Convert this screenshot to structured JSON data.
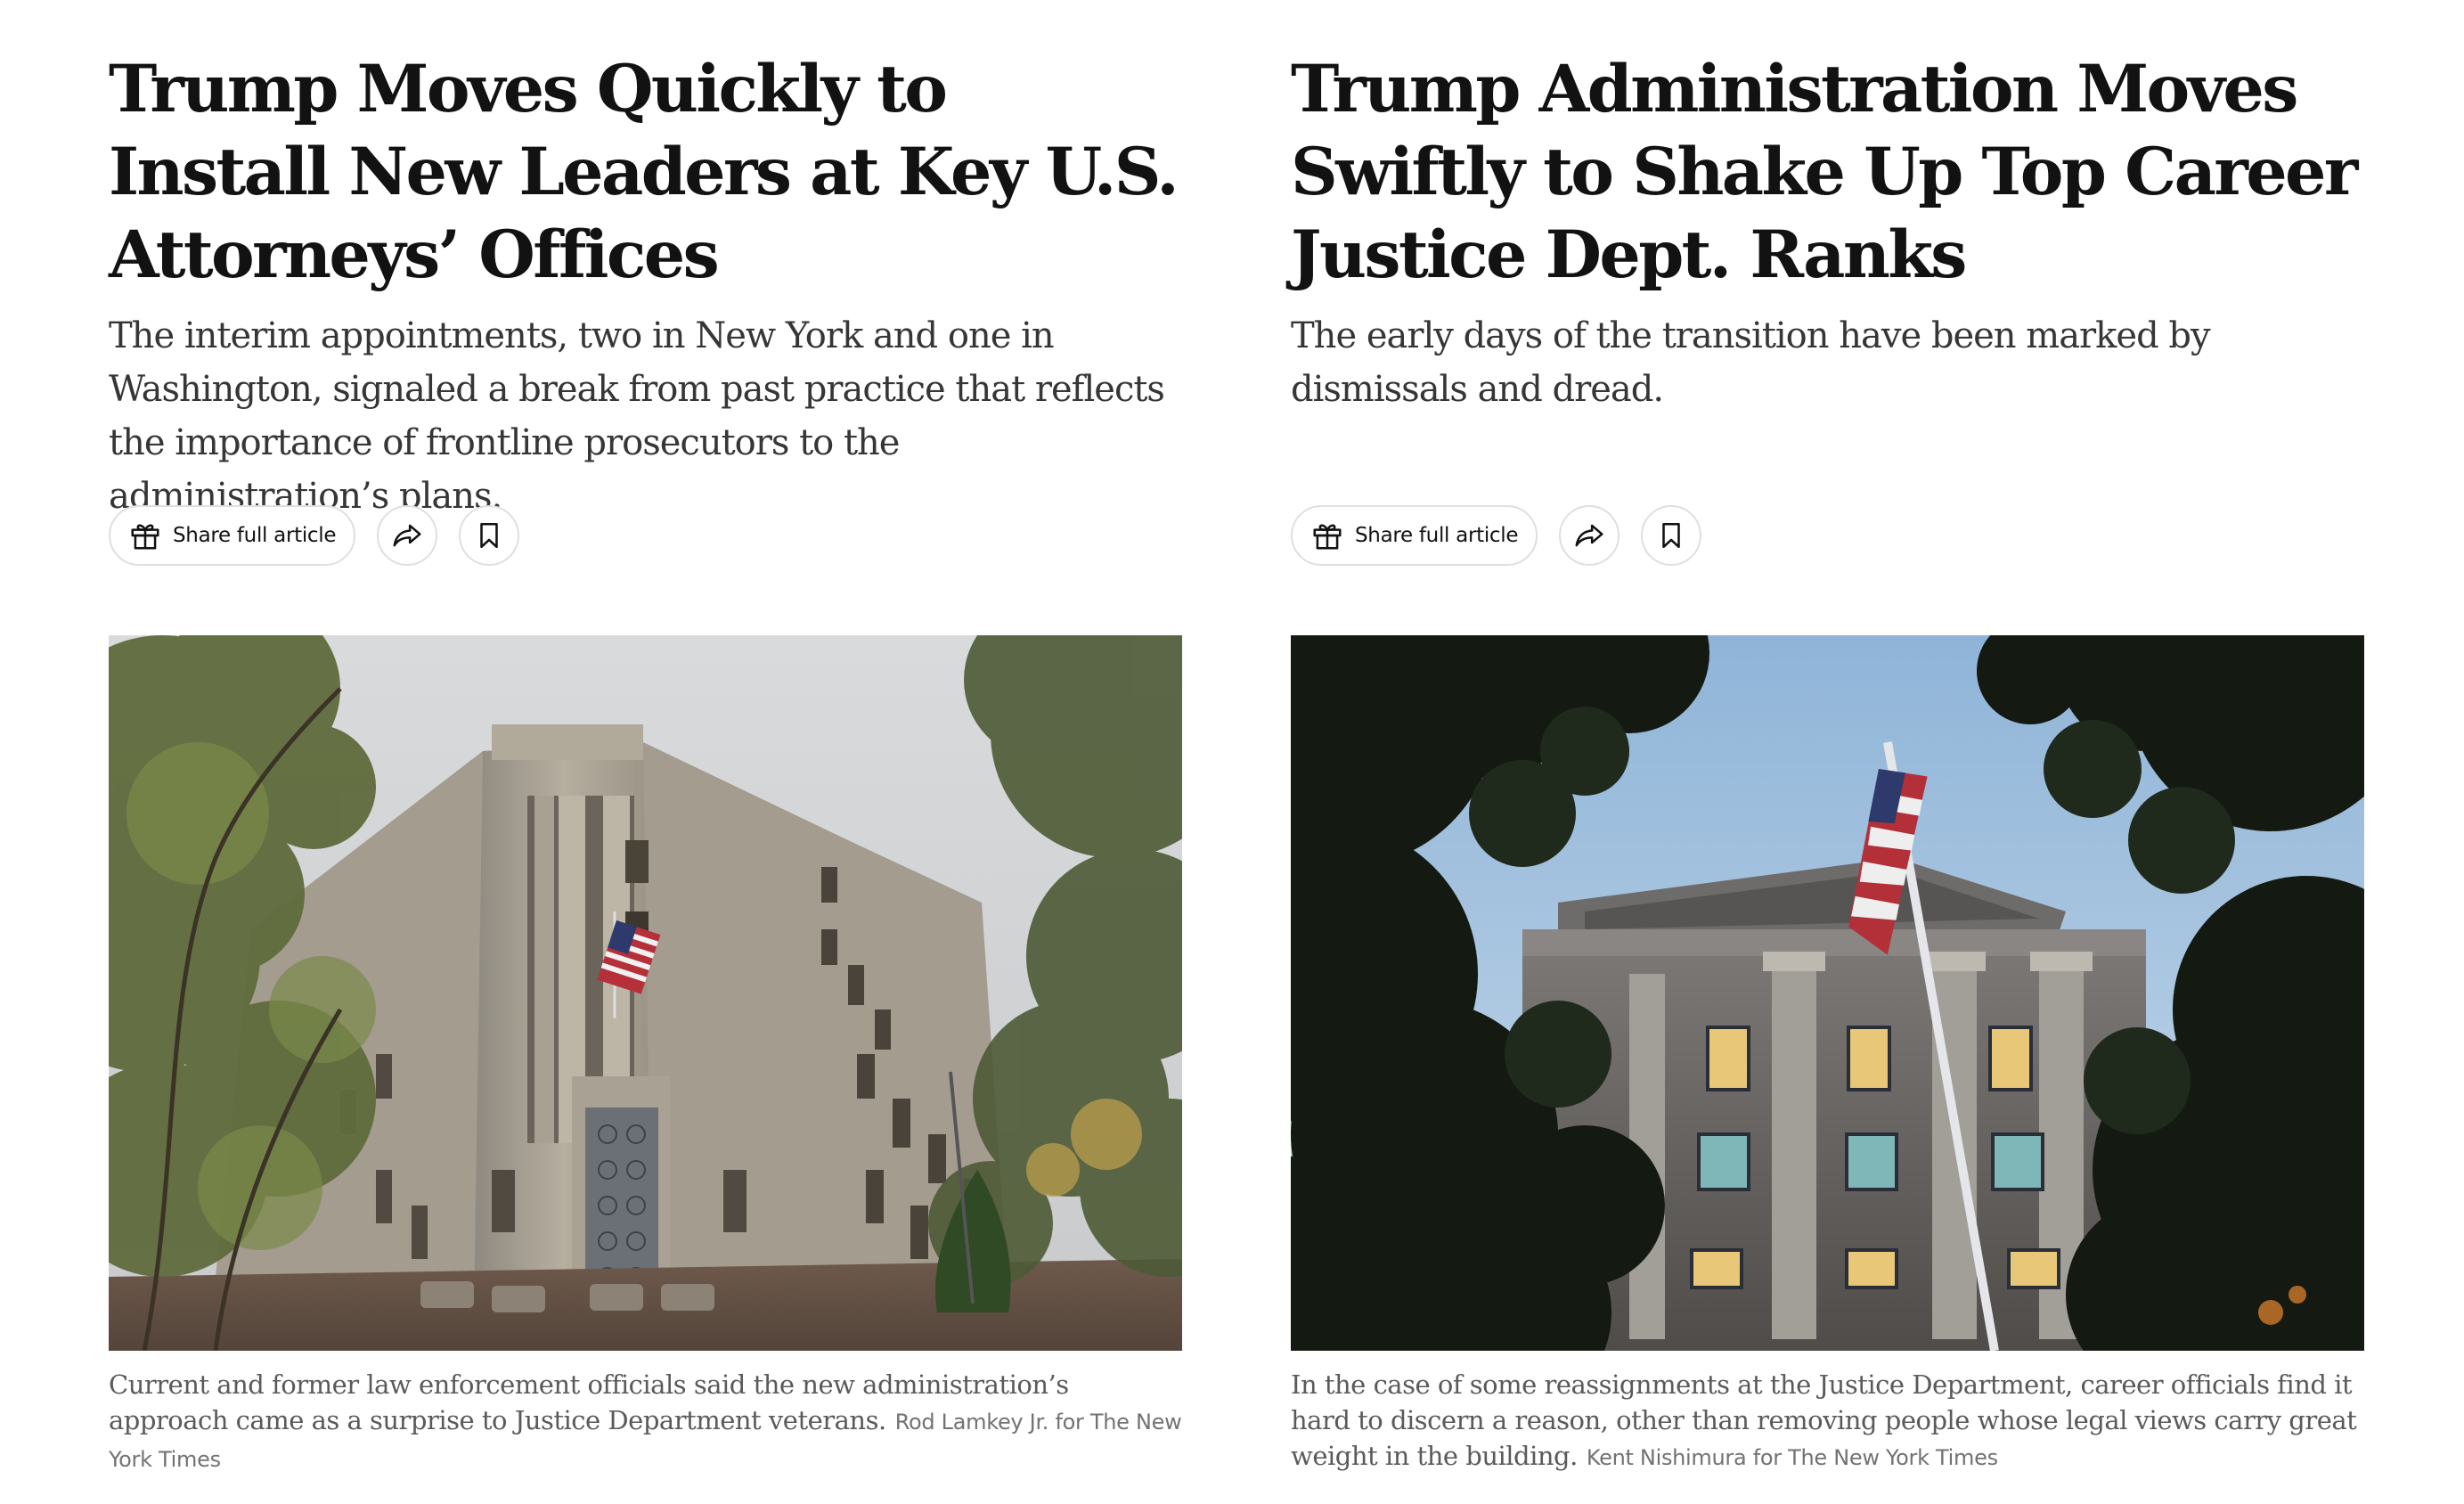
{
  "articles": [
    {
      "headline": "Trump Moves Quickly to Install New Leaders at Key U.S. Attorneys’ Offices",
      "summary": "The interim appointments, two in New York and one in Washington, signaled a break from past practice that reflects the importance of frontline prosecutors to the administration’s plans.",
      "share_label": "Share full article",
      "caption": "Current and former law enforcement officials said the new administration’s approach came as a surprise to Justice Department veterans.",
      "credit": "Rod Lamkey Jr. for The New York Times",
      "icons": [
        "gift-icon",
        "share-arrow-icon",
        "bookmark-icon"
      ]
    },
    {
      "headline": "Trump Administration Moves Swiftly to Shake Up Top Career Justice Dept. Ranks",
      "summary": "The early days of the transition have been marked by dismissals and dread.",
      "share_label": "Share full article",
      "caption": "In the case of some reassignments at the Justice Department, career officials find it hard to discern a reason, other than removing people whose legal views carry great weight in the building.",
      "credit": "Kent Nishimura for The New York Times",
      "icons": [
        "gift-icon",
        "share-arrow-icon",
        "bookmark-icon"
      ]
    }
  ],
  "colors": {
    "headline": "#121212",
    "summary": "#363636",
    "caption": "#5a5a5a",
    "credit": "#727272",
    "button_border": "#dfdfdf"
  }
}
